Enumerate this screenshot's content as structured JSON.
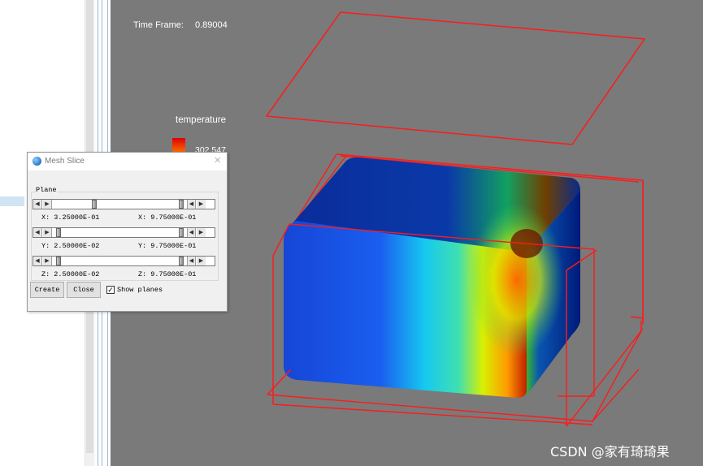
{
  "viewport": {
    "time_frame_label": "Time Frame:",
    "time_frame_value": "0.89004",
    "legend_title": "temperature",
    "legend_max": "302.547",
    "watermark": "CSDN @家有琦琦果"
  },
  "dialog": {
    "title": "Mesh Slice",
    "group_label": "Plane",
    "rows": [
      {
        "min_label": "X: 3.25000E-01",
        "max_label": "X: 9.75000E-01",
        "min_pos": 0.325,
        "max_pos": 0.975
      },
      {
        "min_label": "Y: 2.50000E-02",
        "max_label": "Y: 9.75000E-01",
        "min_pos": 0.025,
        "max_pos": 0.975
      },
      {
        "min_label": "Z: 2.50000E-02",
        "max_label": "Z: 9.75000E-01",
        "min_pos": 0.025,
        "max_pos": 0.975
      }
    ],
    "create_label": "Create",
    "close_label": "Close",
    "show_planes_label": "Show planes",
    "show_planes_checked": true
  },
  "colors": {
    "viewport_bg": "#7a7a7a",
    "plane_outline": "#ff1a1a",
    "accent_blue": "#2a73c8"
  }
}
